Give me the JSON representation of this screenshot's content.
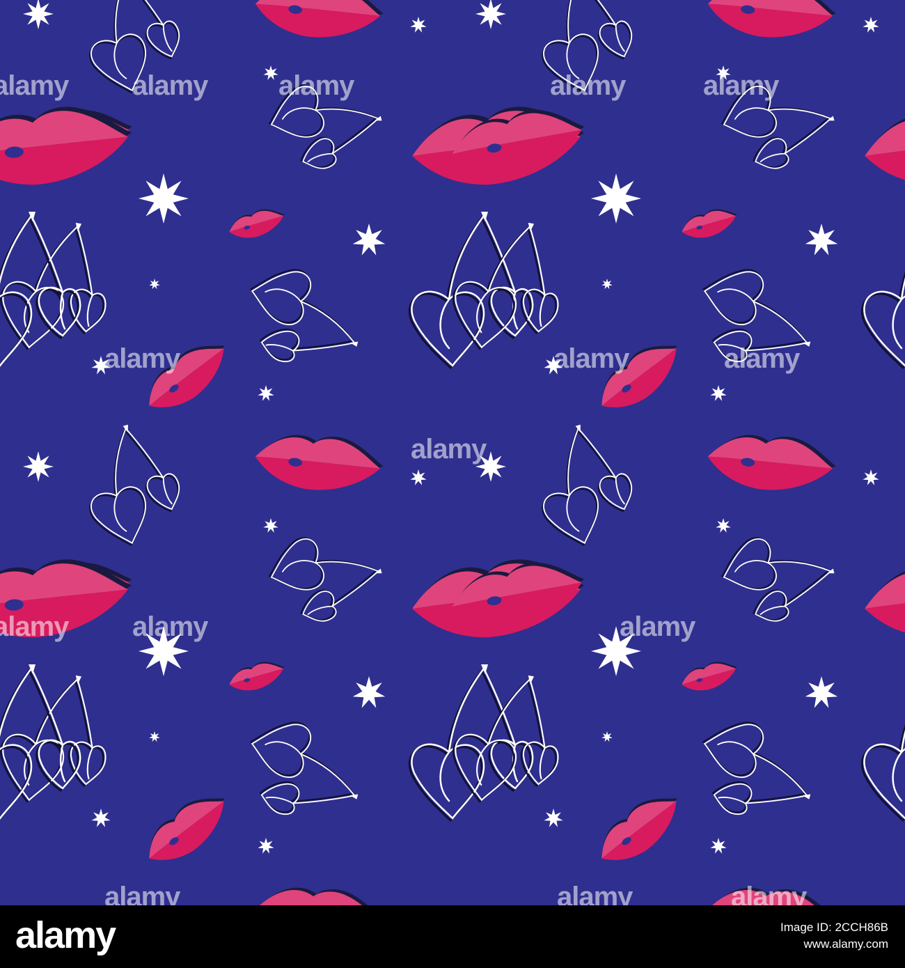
{
  "image": {
    "background_color": "#2f2f8f",
    "lip_colors": {
      "upper": "#e0447c",
      "lower": "#d81b5e",
      "shadow": "#1a1a40"
    },
    "cherry_outline_color": "#ffffff",
    "star_color": "#ffffff",
    "motifs": [
      "lips-icon",
      "cherry-icon",
      "star-icon"
    ]
  },
  "watermark": {
    "text": "alamy"
  },
  "footer": {
    "logo": "alamy",
    "image_id_label": "Image ID: 2CCH86B",
    "site": "www.alamy.com"
  }
}
